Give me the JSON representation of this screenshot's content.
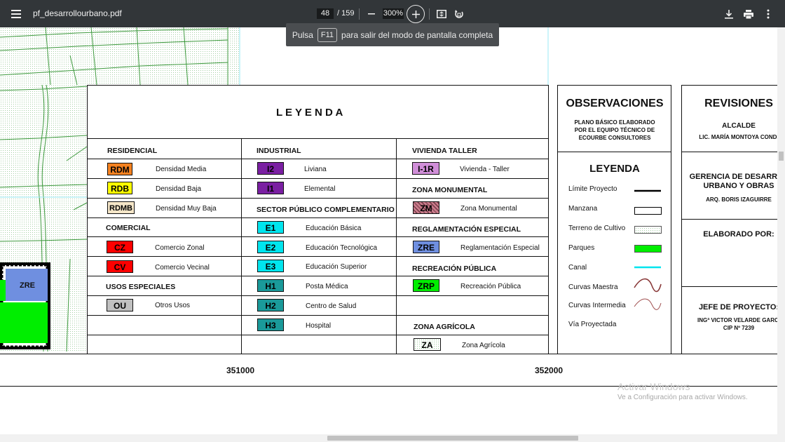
{
  "toolbar": {
    "filename": "pf_desarrollourbano.pdf",
    "page_current": "48",
    "page_total": "/ 159",
    "zoom": "300%"
  },
  "fullscreen_notice": {
    "before": "Pulsa",
    "key": "F11",
    "after": "para salir del modo de pantalla completa"
  },
  "map": {
    "zone_label": "ZRE"
  },
  "legend": {
    "title": "L E Y E N D A",
    "col1": {
      "h_residencial": "RESIDENCIAL",
      "rdm_code": "RDM",
      "rdm_label": "Densidad Media",
      "rdb_code": "RDB",
      "rdb_label": "Densidad Baja",
      "rdmb_code": "RDMB",
      "rdmb_label": "Densidad Muy Baja",
      "h_comercial": "COMERCIAL",
      "cz_code": "CZ",
      "cz_label": "Comercio Zonal",
      "cv_code": "CV",
      "cv_label": "Comercio Vecinal",
      "h_usos": "USOS ESPECIALES",
      "ou_code": "OU",
      "ou_label": "Otros Usos"
    },
    "col2": {
      "h_industrial": "INDUSTRIAL",
      "i2_code": "I2",
      "i2_label": "Liviana",
      "i1_code": "I1",
      "i1_label": "Elemental",
      "h_sector": "SECTOR PÚBLICO COMPLEMENTARIO",
      "e1_code": "E1",
      "e1_label": "Educación Básica",
      "e2_code": "E2",
      "e2_label": "Educación Tecnológica",
      "e3_code": "E3",
      "e3_label": "Educación Superior",
      "h1_code": "H1",
      "h1_label": "Posta Médica",
      "h2_code": "H2",
      "h2_label": "Centro de Salud",
      "h3_code": "H3",
      "h3_label": "Hospital"
    },
    "col3": {
      "h_vivienda": "VIVIENDA TALLER",
      "i1r_code": "I-1R",
      "i1r_label": "Vivienda - Taller",
      "h_monumental": "ZONA MONUMENTAL",
      "zm_code": "ZM",
      "zm_label": "Zona Monumental",
      "h_reglamentacion": "REGLAMENTACIÓN ESPECIAL",
      "zre_code": "ZRE",
      "zre_label": "Reglamentación Especial",
      "h_recreacion": "RECREACIÓN PÚBLICA",
      "zrp_code": "ZRP",
      "zrp_label": "Recreación Pública",
      "h_agricola": "ZONA AGRÍCOLA",
      "za_code": "ZA",
      "za_label": "Zona Agrícola"
    }
  },
  "observaciones": {
    "title": "OBSERVACIONES",
    "line1": "PLANO BÁSICO ELABORADO",
    "line2": "POR EL EQUIPO TÉCNICO DE",
    "line3": "ECOURBE CONSULTORES",
    "legend_title": "LEYENDA",
    "items": {
      "limite": "Límite Proyecto",
      "manzana": "Manzana",
      "terreno": "Terreno de Cultivo",
      "parques": "Parques",
      "canal": "Canal",
      "maestra": "Curvas Maestra",
      "intermedia": "Curvas Intermedia",
      "via": "Vía Proyectada"
    }
  },
  "revisiones": {
    "title": "REVISIONES",
    "alcalde": "ALCALDE",
    "alcalde_name": "LIC. MARÍA MONTOYA CONDI",
    "gerencia1": "GERENCIA DE DESARROL",
    "gerencia2": "URBANO Y OBRAS",
    "gerencia_name": "ARQ. BORIS IZAGUIRRE",
    "elaborado": "ELABORADO POR:",
    "jefe": "JEFE DE PROYECTO:",
    "jefe_name": "INGª VICTOR VELARDE GARCI",
    "cip": "CIP Nº 7239"
  },
  "coords": {
    "x1": "351000",
    "x2": "352000"
  },
  "watermark": {
    "line1": "Activar Windows",
    "line2": "Ve a Configuración para activar Windows."
  },
  "colors": {
    "toolbar": "#323639",
    "rdm": "#f58220",
    "rdb": "#ffff00",
    "rdmb": "#f5e6c8",
    "cz": "#ff0000",
    "cv": "#ff0000",
    "ou": "#c0c0c0",
    "industrial": "#7a1fa2",
    "education": "#00e5ee",
    "health": "#1a9a9a",
    "vivienda": "#d08ed8",
    "zm": "#c87a8a",
    "zre": "#6f8fe0",
    "zrp": "#00ee00",
    "park": "#00ee00",
    "canal": "#00e5ee"
  }
}
